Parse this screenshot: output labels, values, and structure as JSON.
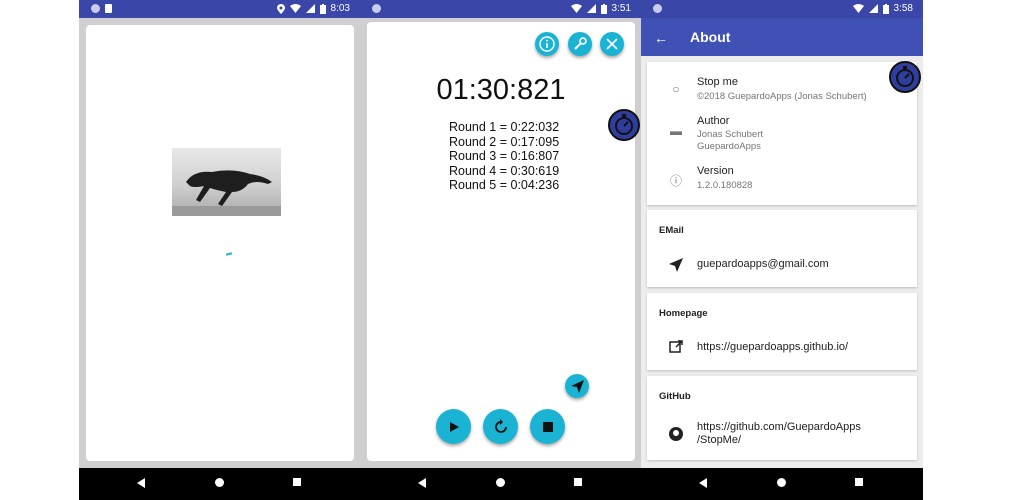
{
  "screens": [
    {
      "status_time": "8:03",
      "colors": {
        "accent": "#1ab3d4",
        "statusbar": "#3a46a8"
      }
    },
    {
      "status_time": "3:51",
      "timer": "01:30:821",
      "rounds": [
        "Round 1 = 0:22:032",
        "Round 2 = 0:17:095",
        "Round 3 = 0:16:807",
        "Round 4 = 0:30:619",
        "Round 5 = 0:04:236"
      ],
      "icons": {
        "info": "info-icon",
        "settings": "wrench-icon",
        "close": "close-icon",
        "share": "send-icon",
        "play": "play-icon",
        "reset": "reset-icon",
        "stop": "stop-icon"
      }
    },
    {
      "status_time": "3:58",
      "title": "About",
      "app_info": [
        {
          "label": "Stop me",
          "sub": "©2018 GuepardoApps (Jonas Schubert)"
        },
        {
          "label": "Author",
          "sub": "Jonas Schubert",
          "sub2": "GuepardoApps"
        },
        {
          "label": "Version",
          "sub": "1.2.0.180828"
        }
      ],
      "email": {
        "title": "EMail",
        "value": "guepardoapps@gmail.com"
      },
      "homepage": {
        "title": "Homepage",
        "value": "https://guepardoapps.github.io/"
      },
      "github": {
        "title": "GitHub",
        "line1": "https://github.com/GuepardoApps",
        "line2": "/StopMe/"
      }
    }
  ]
}
